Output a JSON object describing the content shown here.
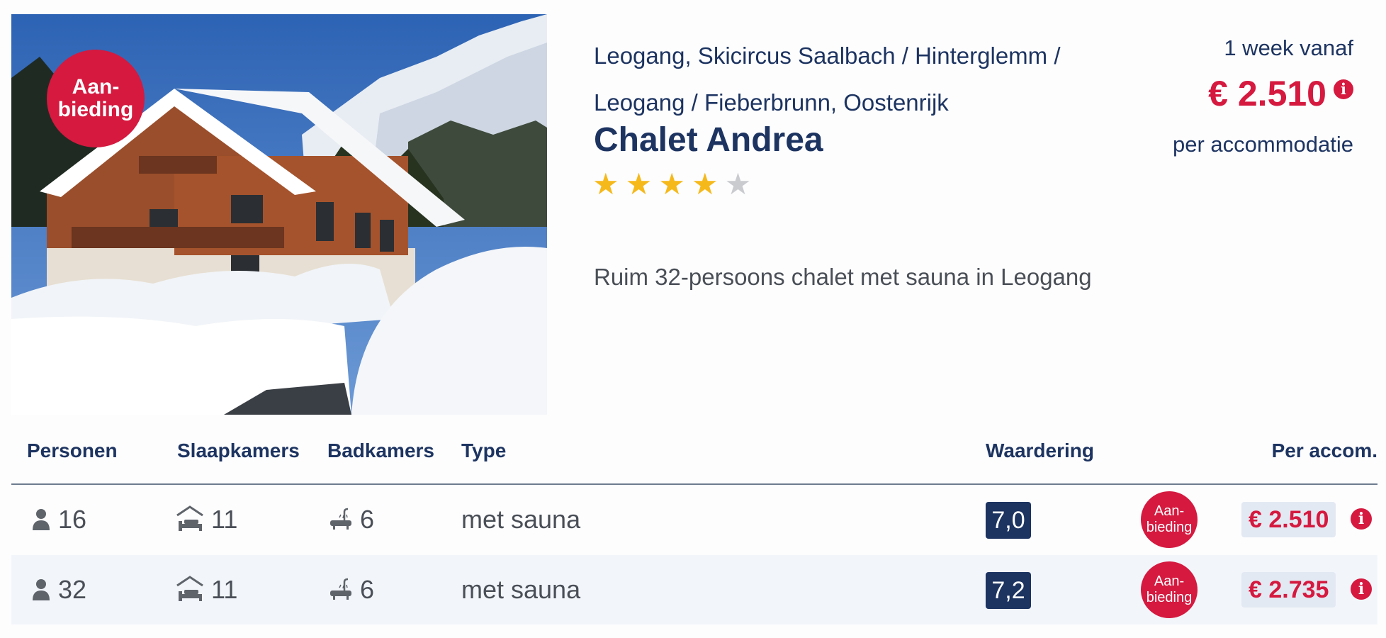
{
  "offer_badge": "Aan-\nbieding",
  "location": "Leogang, Skicircus Saalbach / Hinterglemm / Leogang / Fieberbrunn, Oostenrijk",
  "title": "Chalet Andrea",
  "rating_stars": 4,
  "rating_max": 5,
  "description": "Ruim 32-persoons chalet met sauna in Leogang",
  "price": {
    "from_label": "1 week vanaf",
    "amount": "€ 2.510",
    "info_icon": "info-icon",
    "per_label": "per accommodatie"
  },
  "table": {
    "headers": {
      "persons": "Personen",
      "bedrooms": "Slaapkamers",
      "bathrooms": "Badkamers",
      "type": "Type",
      "rating": "Waardering",
      "price": "Per accom."
    },
    "rows": [
      {
        "persons": "16",
        "bedrooms": "11",
        "bathrooms": "6",
        "type": "met sauna",
        "rating": "7,0",
        "badge": "Aan-\nbieding",
        "price": "€ 2.510"
      },
      {
        "persons": "32",
        "bedrooms": "11",
        "bathrooms": "6",
        "type": "met sauna",
        "rating": "7,2",
        "badge": "Aan-\nbieding",
        "price": "€ 2.735"
      }
    ]
  },
  "colors": {
    "brand": "#1d3461",
    "accent": "#d5193f",
    "star": "#f6b91b"
  }
}
